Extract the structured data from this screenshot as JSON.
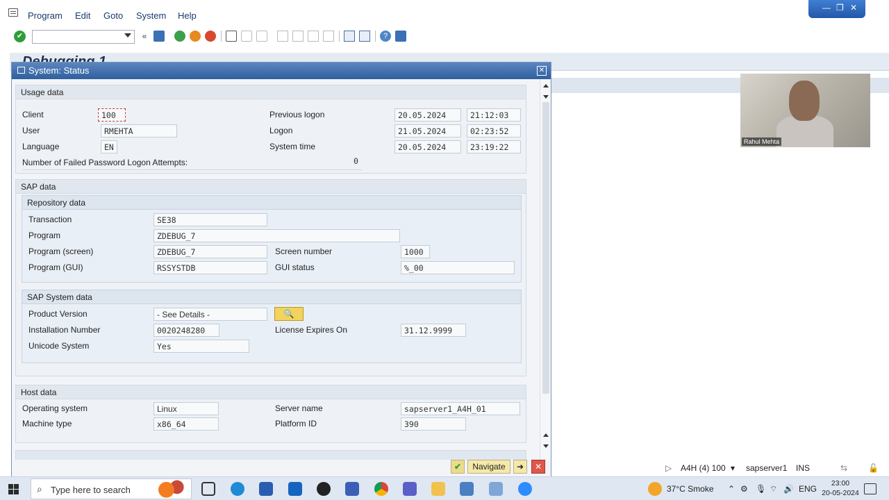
{
  "menu": {
    "items": [
      "Program",
      "Edit",
      "Goto",
      "System",
      "Help"
    ]
  },
  "window_controls": {
    "minimize": "—",
    "restore": "❐",
    "close": "✕"
  },
  "main_window": {
    "title": "Debugging 1"
  },
  "video": {
    "participant": "Rahul Mehta"
  },
  "dialog": {
    "title": "System: Status",
    "usage": {
      "heading": "Usage data",
      "client_label": "Client",
      "client": "100",
      "user_label": "User",
      "user": "RMEHTA",
      "language_label": "Language",
      "language": "EN",
      "failed_label": "Number of Failed Password Logon Attempts:",
      "failed": "0",
      "prev_logon_label": "Previous logon",
      "prev_logon_date": "20.05.2024",
      "prev_logon_time": "21:12:03",
      "logon_label": "Logon",
      "logon_date": "21.05.2024",
      "logon_time": "02:23:52",
      "system_time_label": "System time",
      "system_time_date": "20.05.2024",
      "system_time_time": "23:19:22"
    },
    "sap": {
      "heading": "SAP data",
      "repo": {
        "heading": "Repository data",
        "transaction_label": "Transaction",
        "transaction": "SE38",
        "program_label": "Program",
        "program": "ZDEBUG_7",
        "program_screen_label": "Program (screen)",
        "program_screen": "ZDEBUG_7",
        "program_gui_label": "Program (GUI)",
        "program_gui": "RSSYSTDB",
        "screen_number_label": "Screen number",
        "screen_number": "1000",
        "gui_status_label": "GUI status",
        "gui_status": "%_00"
      },
      "system": {
        "heading": "SAP System data",
        "product_label": "Product Version",
        "product": "- See Details -",
        "install_label": "Installation Number",
        "install": "0020248280",
        "unicode_label": "Unicode System",
        "unicode": "Yes",
        "license_label": "License Expires On",
        "license": "31.12.9999"
      }
    },
    "host": {
      "heading": "Host data",
      "os_label": "Operating system",
      "os": "Linux",
      "machine_label": "Machine type",
      "machine": "x86_64",
      "server_label": "Server name",
      "server": "sapserver1_A4H_01",
      "platform_label": "Platform ID",
      "platform": "390"
    },
    "footer": {
      "navigate": "Navigate"
    }
  },
  "statusbar": {
    "system": "A4H (4) 100",
    "server": "sapserver1",
    "mode": "INS"
  },
  "taskbar": {
    "search_placeholder": "Type here to search",
    "weather": "37°C Smoke",
    "language": "ENG",
    "time": "23:00",
    "date": "20-05-2024"
  },
  "colors": {
    "title_bar": "#2f5f9e",
    "ok_green": "#2e9e3a",
    "cancel_red": "#e0574a",
    "detail_button": "#f2d35c"
  }
}
